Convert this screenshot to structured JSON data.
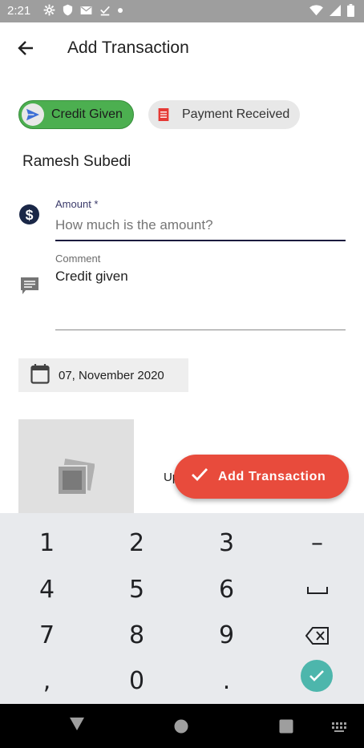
{
  "status_bar": {
    "time": "2:21"
  },
  "app_bar": {
    "title": "Add Transaction"
  },
  "chips": {
    "credit_given": "Credit Given",
    "payment_received": "Payment Received"
  },
  "customer": {
    "name": "Ramesh Subedi"
  },
  "amount": {
    "label": "Amount *",
    "placeholder": "How much is the amount?",
    "value": ""
  },
  "comment": {
    "label": "Comment",
    "value": "Credit given"
  },
  "date": {
    "value": "07, November 2020"
  },
  "upload": {
    "label": "Up"
  },
  "fab": {
    "label": "Add Transaction"
  },
  "keyboard": {
    "keys": [
      "1",
      "2",
      "3",
      "–",
      "4",
      "5",
      "6",
      "␣",
      "7",
      "8",
      "9",
      "⌫",
      ",",
      "0",
      ".",
      "✓"
    ]
  },
  "colors": {
    "credit_chip": "#4caf50",
    "fab": "#e84b3c",
    "done_key": "#4db6ac",
    "status_bar": "#9e9e9e"
  }
}
